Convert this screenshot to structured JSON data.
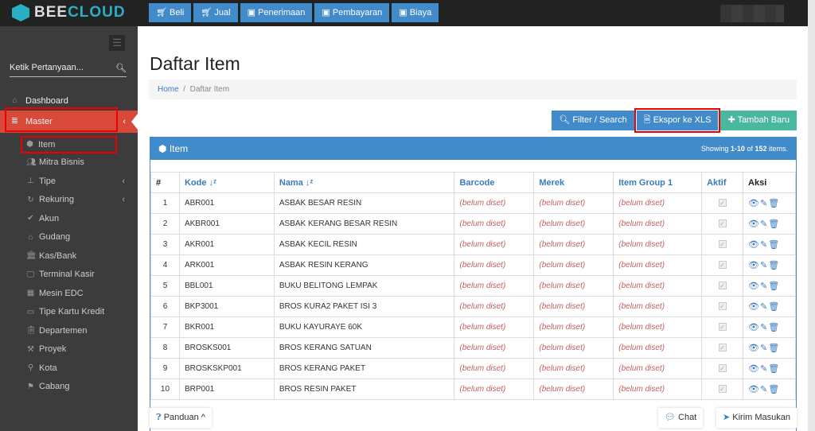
{
  "brand": {
    "part1": "BEE",
    "part2": "CLOUD"
  },
  "topnav": [
    {
      "label": "Beli",
      "icon": "cart-icon"
    },
    {
      "label": "Jual",
      "icon": "cart-icon"
    },
    {
      "label": "Penerimaan",
      "icon": "money-icon"
    },
    {
      "label": "Pembayaran",
      "icon": "money-icon"
    },
    {
      "label": "Biaya",
      "icon": "money-icon"
    }
  ],
  "sidebar": {
    "search_placeholder": "Ketik Pertanyaan...",
    "dashboard": "Dashboard",
    "master": "Master",
    "items": [
      "Item",
      "Mitra Bisnis",
      "Tipe",
      "Rekuring",
      "Akun",
      "Gudang",
      "Kas/Bank",
      "Terminal Kasir",
      "Mesin EDC",
      "Tipe Kartu Kredit",
      "Departemen",
      "Proyek",
      "Kota",
      "Cabang"
    ]
  },
  "page": {
    "title": "Daftar Item",
    "breadcrumb": [
      "Home",
      "Daftar Item"
    ]
  },
  "actions": {
    "filter": "Filter / Search",
    "export": "Ekspor ke XLS",
    "add": "Tambah Baru"
  },
  "panel": {
    "title": "Item",
    "showing_prefix": "Showing ",
    "showing_range": "1-10",
    "showing_mid": " of ",
    "showing_total": "152",
    "showing_suffix": " items."
  },
  "table": {
    "headers": [
      "#",
      "Kode",
      "Nama",
      "Barcode",
      "Merek",
      "Item Group 1",
      "Aktif",
      "Aksi"
    ],
    "unset": "(belum diset)",
    "rows": [
      [
        "1",
        "ABR001",
        "ASBAK BESAR RESIN"
      ],
      [
        "2",
        "AKBR001",
        "ASBAK KERANG BESAR RESIN"
      ],
      [
        "3",
        "AKR001",
        "ASBAK KECIL RESIN"
      ],
      [
        "4",
        "ARK001",
        "ASBAK RESIN KERANG"
      ],
      [
        "5",
        "BBL001",
        "BUKU BELITONG LEMPAK"
      ],
      [
        "6",
        "BKP3001",
        "BROS KURA2 PAKET ISI 3"
      ],
      [
        "7",
        "BKR001",
        "BUKU KAYURAYE 60K"
      ],
      [
        "8",
        "BROSKS001",
        "BROS KERANG SATUAN"
      ],
      [
        "9",
        "BROSKSKP001",
        "BROS KERANG PAKET"
      ],
      [
        "10",
        "BRP001",
        "BROS RESIN PAKET"
      ]
    ]
  },
  "footer": {
    "guide": "Panduan",
    "chat": "Chat",
    "feedback": "Kirim Masukan"
  },
  "colors": {
    "primary": "#428bca",
    "danger": "#d9493a",
    "success": "#49b89e"
  }
}
